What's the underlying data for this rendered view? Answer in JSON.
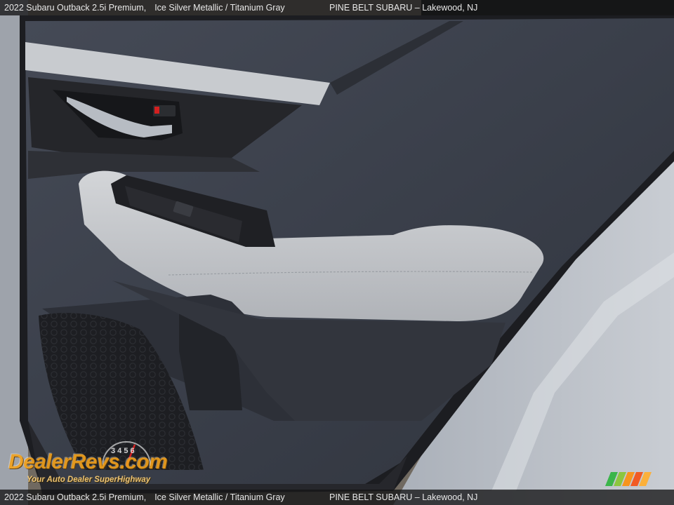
{
  "caption": {
    "model": "2022 Subaru Outback 2.5i Premium,",
    "color": "Ice Silver Metallic / Titanium Gray",
    "dealer": "PINE BELT SUBARU – Lakewood, NJ"
  },
  "watermark": {
    "brand": "DealerRevs.com",
    "tagline": "Your Auto Dealer SuperHighway",
    "gauge_digits": "3 4 5 6"
  },
  "colors": {
    "upholstery": "#3a3f4a",
    "leather": "#c4c7cb",
    "trim": "#2b2c30",
    "body_paint": "#b9bec6",
    "watermark_orange": "#f4a21c"
  }
}
